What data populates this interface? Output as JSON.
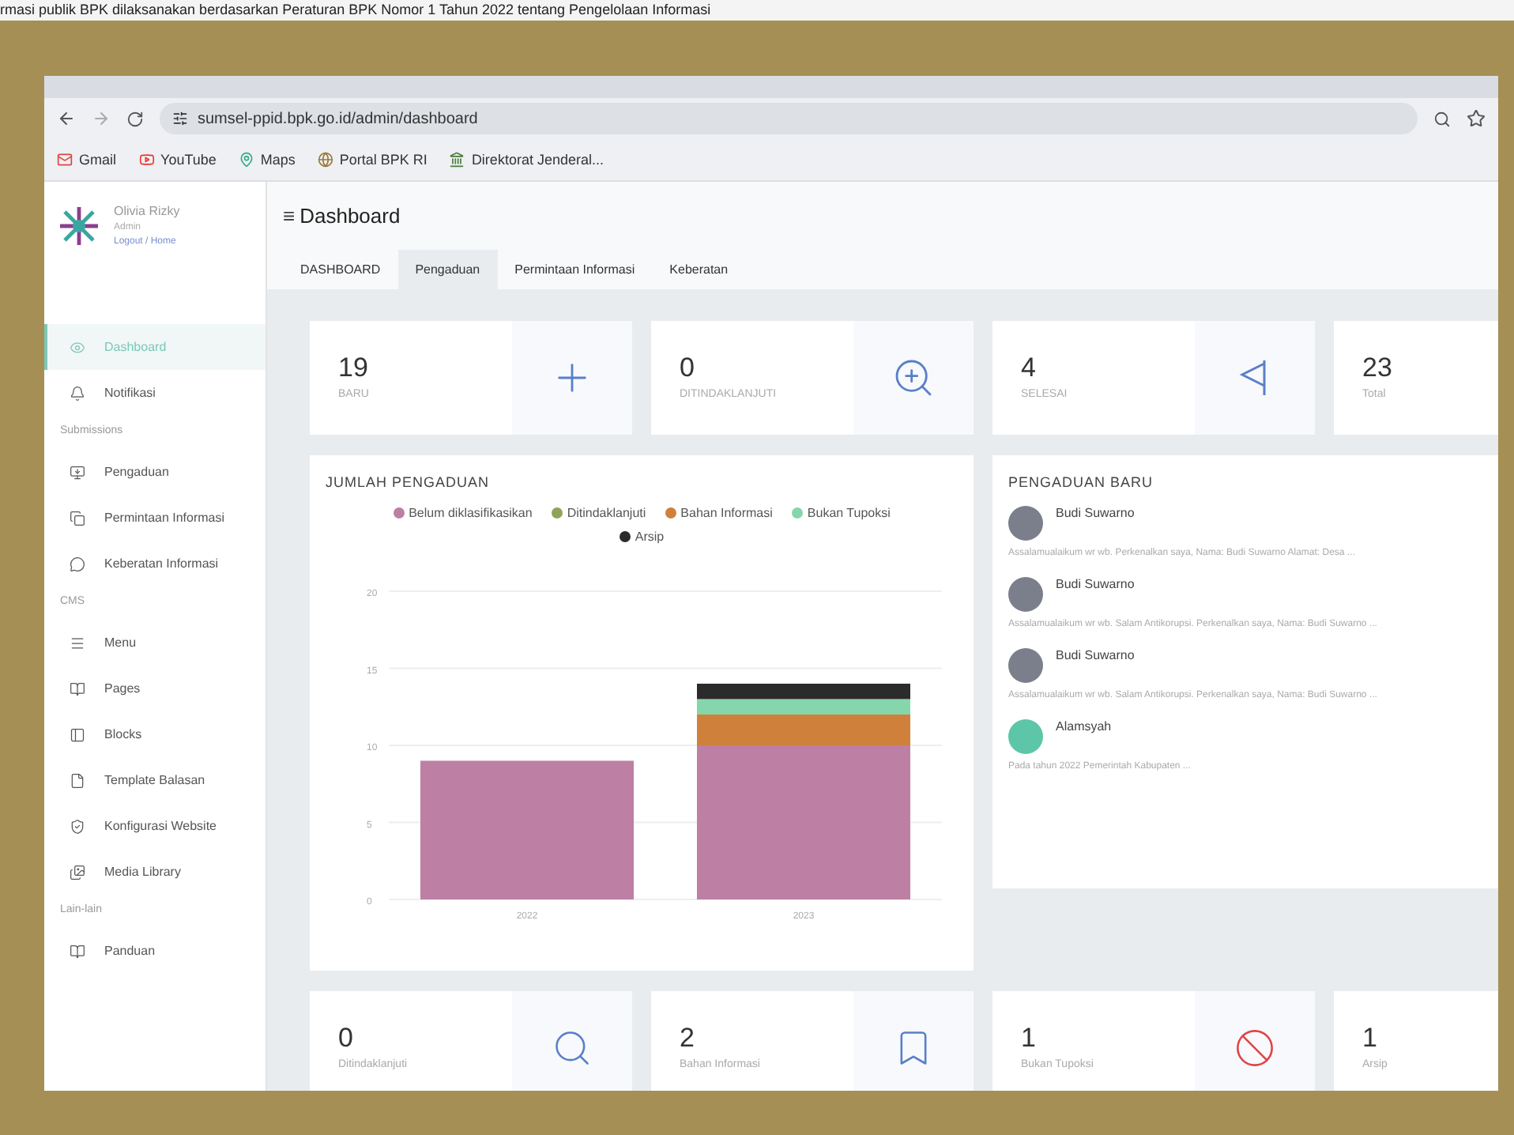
{
  "slide_caption": "rmasi publik BPK dilaksanakan berdasarkan Peraturan BPK Nomor 1 Tahun 2022 tentang Pengelolaan Informasi",
  "browser": {
    "url": "sumsel-ppid.bpk.go.id/admin/dashboard",
    "bookmarks": [
      "Gmail",
      "YouTube",
      "Maps",
      "Portal BPK RI",
      "Direktorat Jenderal..."
    ]
  },
  "sidebar": {
    "user_name": "Olivia Rizky",
    "role": "Admin",
    "user_links": "Logout / Home",
    "sections": [
      {
        "items": [
          {
            "label": "Dashboard",
            "selected": true
          },
          {
            "label": "Notifikasi",
            "selected": false
          }
        ]
      },
      {
        "heading": "Submissions",
        "items": [
          {
            "label": "Pengaduan",
            "selected": false
          },
          {
            "label": "Permintaan Informasi",
            "selected": false
          },
          {
            "label": "Keberatan Informasi",
            "selected": false
          }
        ]
      },
      {
        "heading": "CMS",
        "items": [
          {
            "label": "Menu",
            "selected": false
          },
          {
            "label": "Pages",
            "selected": false
          },
          {
            "label": "Blocks",
            "selected": false
          },
          {
            "label": "Template Balasan",
            "selected": false
          },
          {
            "label": "Konfigurasi Website",
            "selected": false
          },
          {
            "label": "Media Library",
            "selected": false
          }
        ]
      },
      {
        "heading": "Lain-lain",
        "items": [
          {
            "label": "Panduan",
            "selected": false
          }
        ]
      }
    ]
  },
  "menu_toggle": "≡",
  "page_title": "Dashboard",
  "tabs": [
    {
      "label": "DASHBOARD",
      "selected": false
    },
    {
      "label": "Pengaduan",
      "selected": true
    },
    {
      "label": "Permintaan Informasi",
      "selected": false
    },
    {
      "label": "Keberatan",
      "selected": false
    }
  ],
  "stat_cards": [
    {
      "value": "19",
      "label": "BARU"
    },
    {
      "value": "0",
      "label": "DITINDAKLANJUTI"
    },
    {
      "value": "4",
      "label": "SELESAI"
    },
    {
      "value": "23",
      "label": "Total"
    }
  ],
  "chart_panel": {
    "title": "JUMLAH PENGADUAN",
    "chart_data": {
      "type": "bar",
      "stacked": true,
      "grid": true,
      "categories": [
        "2022",
        "2023"
      ],
      "yticks": [
        0,
        5,
        10,
        15,
        20
      ],
      "ylim": [
        0,
        20
      ],
      "series": [
        {
          "name": "Belum diklasifikasikan",
          "color": "#bd7fa4",
          "values": [
            9,
            10
          ]
        },
        {
          "name": "Ditindaklanjuti",
          "color": "#8fa35a",
          "values": [
            0,
            0
          ]
        },
        {
          "name": "Bahan Informasi",
          "color": "#cf813b",
          "values": [
            0,
            2
          ]
        },
        {
          "name": "Bukan Tupoksi",
          "color": "#86d6ac",
          "values": [
            0,
            1
          ]
        },
        {
          "name": "Arsip",
          "color": "#2b2b2b",
          "values": [
            0,
            1
          ]
        }
      ]
    }
  },
  "new_complaints": {
    "title": "PENGADUAN BARU",
    "items": [
      {
        "name": "Budi Suwarno",
        "text": "Assalamualaikum wr wb. Perkenalkan saya, Nama: Budi Suwarno Alamat: Desa ..."
      },
      {
        "name": "Budi Suwarno",
        "text": "Assalamualaikum wr wb. Salam Antikorupsi. Perkenalkan saya, Nama: Budi Suwarno ..."
      },
      {
        "name": "Budi Suwarno",
        "text": "Assalamualaikum wr wb. Salam Antikorupsi. Perkenalkan saya, Nama: Budi Suwarno ..."
      },
      {
        "name": "Alamsyah",
        "text": "Pada tahun 2022 Pemerintah Kabupaten ..."
      }
    ]
  },
  "bottom_cards": [
    {
      "value": "0",
      "label": "Ditindaklanjuti"
    },
    {
      "value": "2",
      "label": "Bahan Informasi"
    },
    {
      "value": "1",
      "label": "Bukan Tupoksi"
    },
    {
      "value": "1",
      "label": "Arsip"
    }
  ]
}
